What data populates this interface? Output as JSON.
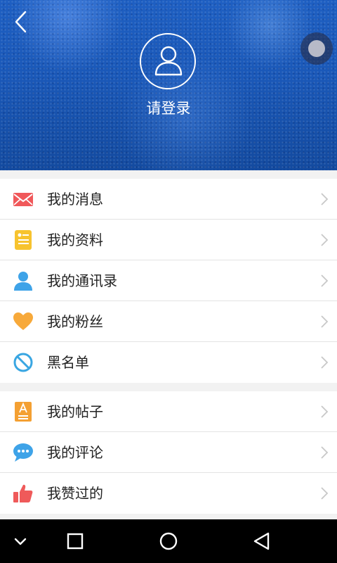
{
  "header": {
    "login_label": "请登录"
  },
  "menu": {
    "group1": [
      {
        "label": "我的消息",
        "icon": "mail-icon"
      },
      {
        "label": "我的资料",
        "icon": "profile-card-icon"
      },
      {
        "label": "我的通讯录",
        "icon": "contacts-person-icon"
      },
      {
        "label": "我的粉丝",
        "icon": "heart-icon"
      },
      {
        "label": "黑名单",
        "icon": "block-icon"
      }
    ],
    "group2": [
      {
        "label": "我的帖子",
        "icon": "post-document-icon"
      },
      {
        "label": "我的评论",
        "icon": "comment-bubble-icon"
      },
      {
        "label": "我赞过的",
        "icon": "thumbs-up-icon"
      }
    ]
  },
  "colors": {
    "header_blue": "#1a58b8",
    "mail_red": "#f0585a",
    "profile_yellow": "#f7c32e",
    "contacts_blue": "#3ea3e8",
    "heart_orange": "#f7a93a",
    "block_blue": "#39a6e2",
    "post_orange": "#f4a032",
    "comment_blue": "#3ea3e8",
    "thumb_red": "#ef5a5a"
  }
}
